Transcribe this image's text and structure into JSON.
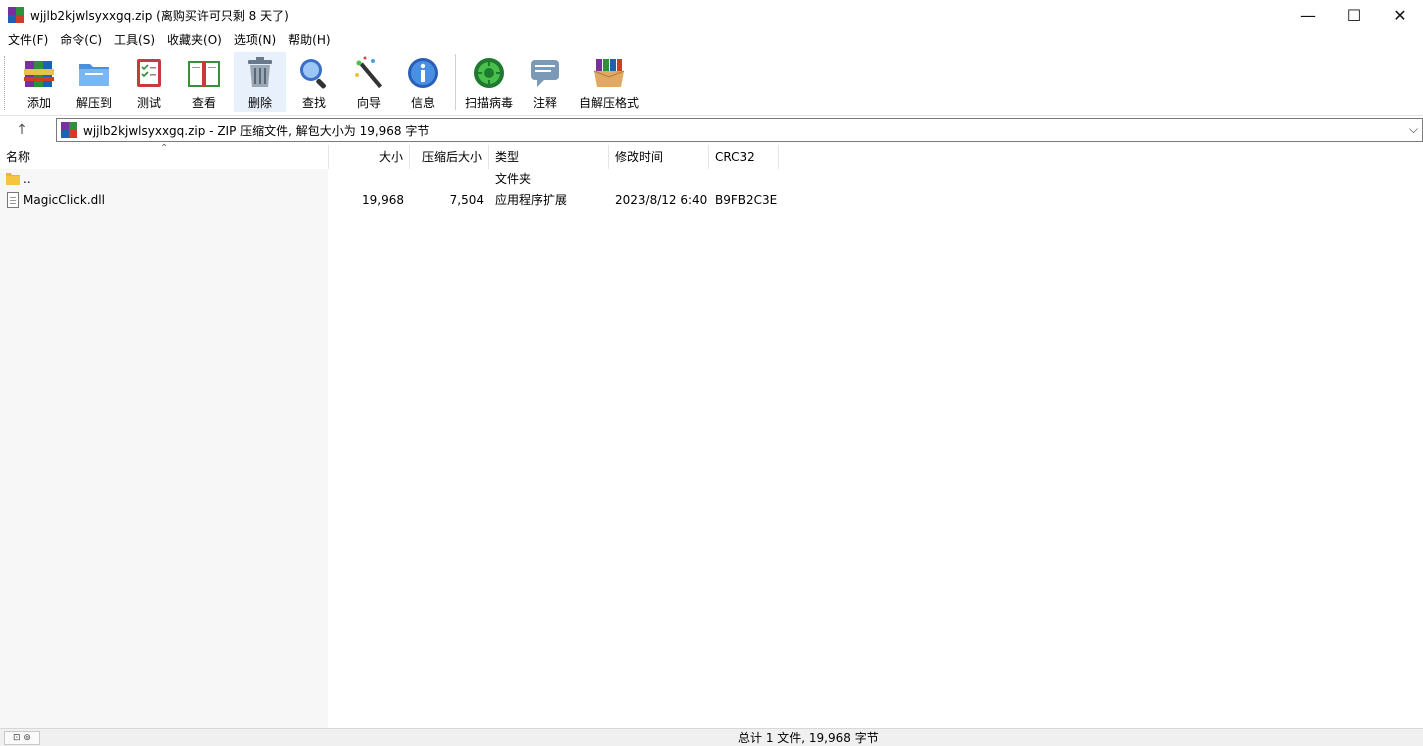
{
  "window": {
    "title": "wjjlb2kjwlsyxxgq.zip (离购买许可只剩 8 天了)",
    "minimize": "—",
    "maximize": "☐",
    "close": "✕"
  },
  "menu": [
    "文件(F)",
    "命令(C)",
    "工具(S)",
    "收藏夹(O)",
    "选项(N)",
    "帮助(H)"
  ],
  "toolbar": {
    "add": "添加",
    "extract": "解压到",
    "test": "测试",
    "view": "查看",
    "delete": "删除",
    "find": "查找",
    "wizard": "向导",
    "info": "信息",
    "scan": "扫描病毒",
    "comment": "注释",
    "sfx": "自解压格式"
  },
  "address": {
    "up": "↑",
    "text": "wjjlb2kjwlsyxxgq.zip - ZIP 压缩文件, 解包大小为 19,968 字节",
    "dropdown": "⌵"
  },
  "columns": {
    "name": "名称",
    "size": "大小",
    "packed": "压缩后大小",
    "type": "类型",
    "modified": "修改时间",
    "crc": "CRC32",
    "sort_indicator": "⌃"
  },
  "rows": [
    {
      "name": "..",
      "size": "",
      "packed": "",
      "type": "文件夹",
      "modified": "",
      "crc": ""
    },
    {
      "name": "MagicClick.dll",
      "size": "19,968",
      "packed": "7,504",
      "type": "应用程序扩展",
      "modified": "2023/8/12 6:40",
      "crc": "B9FB2C3E"
    }
  ],
  "status": {
    "icons": "⊡ ⊚",
    "summary": "总计 1 文件, 19,968 字节"
  },
  "colors": {
    "accent": "#1a66c4",
    "folder": "#f5c542",
    "active_button": "#e8f0fb"
  }
}
